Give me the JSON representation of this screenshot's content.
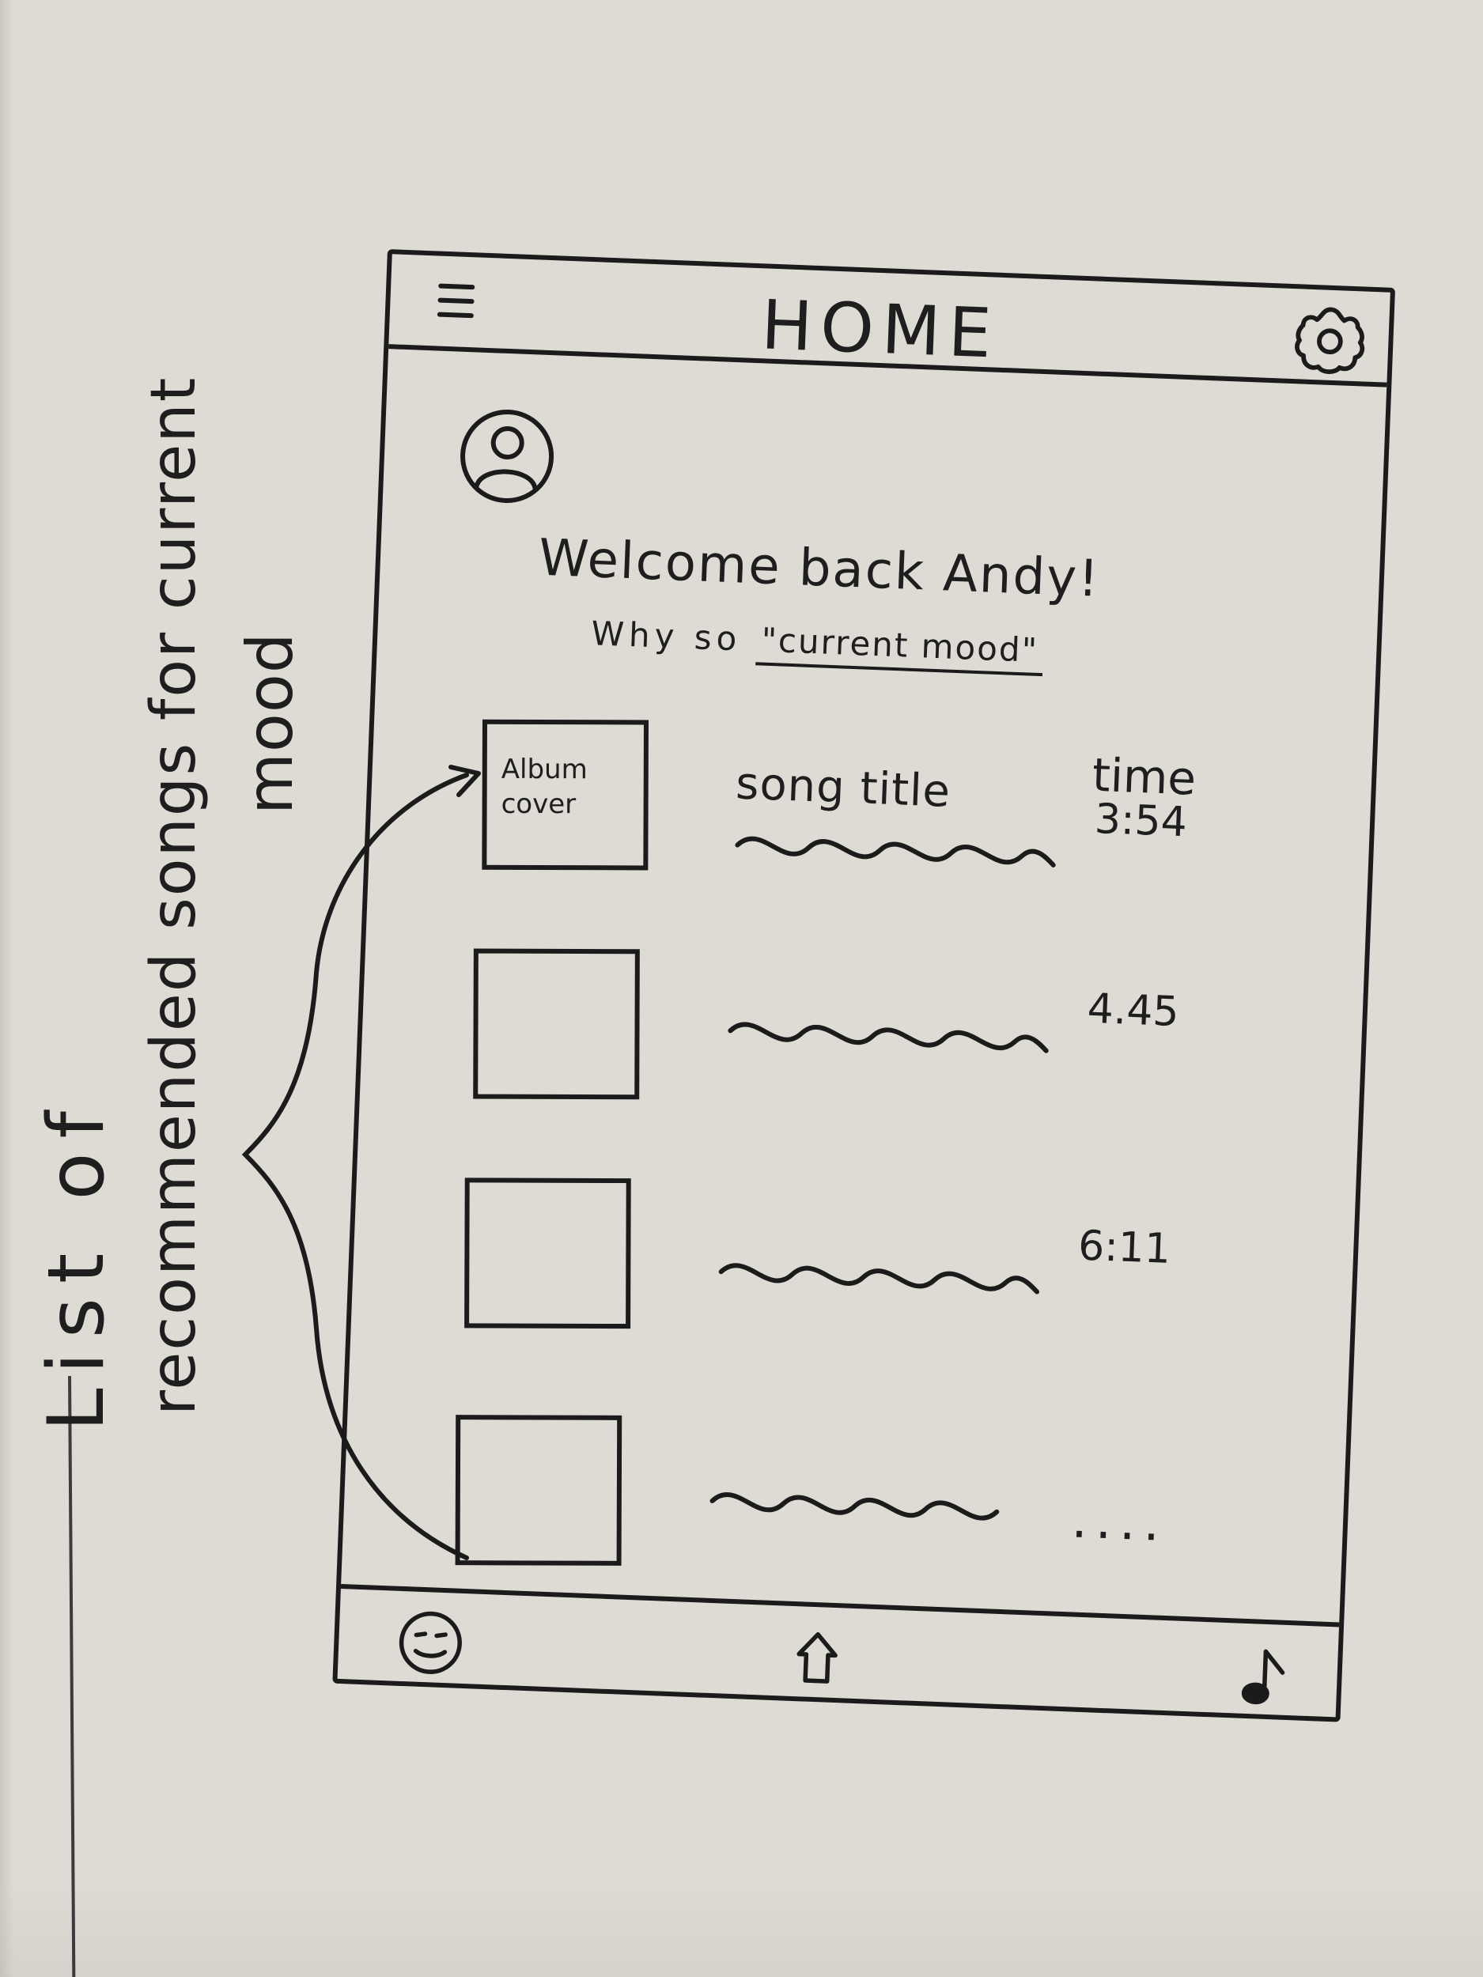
{
  "note": {
    "line1": "List of",
    "line2": "recommended songs for current",
    "line3": "mood"
  },
  "app": {
    "title": "HOME",
    "welcome_text": "Welcome back Andy!",
    "mood_prefix": "Why so",
    "mood_value": "\"current mood\""
  },
  "songs": [
    {
      "album_label": "Album\ncover",
      "title": "song title",
      "time_label": "time",
      "time": "3:54"
    },
    {
      "time": "4.45"
    },
    {
      "time": "6:11"
    },
    {
      "time": "...."
    }
  ],
  "icons": {
    "menu": "menu-icon",
    "settings": "gear-icon",
    "avatar": "user-icon",
    "mood": "smiley-icon",
    "home": "home-icon",
    "music": "music-note-icon"
  }
}
